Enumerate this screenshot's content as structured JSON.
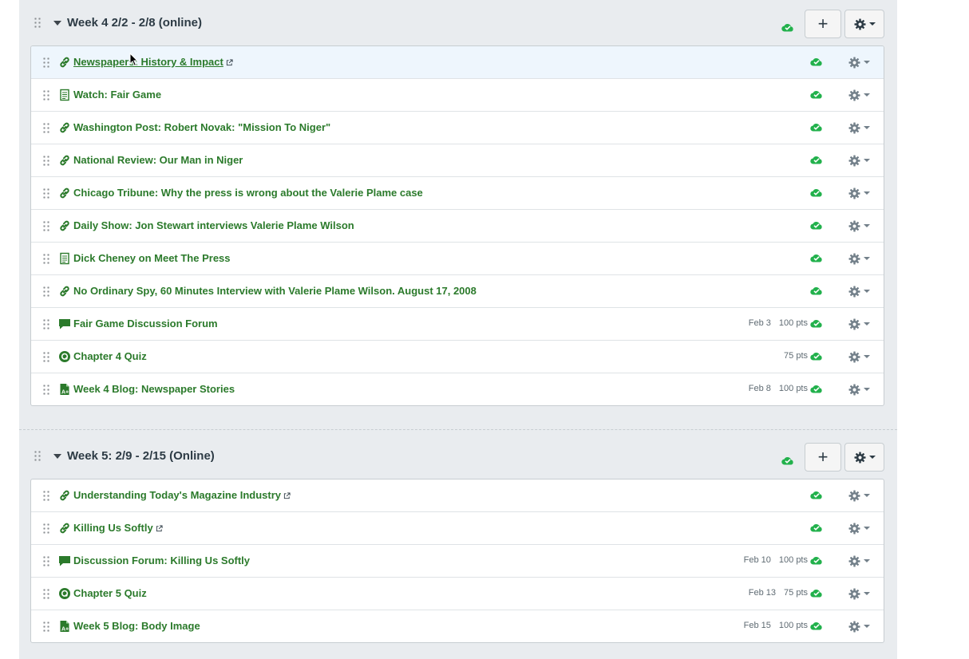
{
  "modules": [
    {
      "title": "Week 4 2/2 - 2/8 (online)",
      "add_label": "+",
      "items": [
        {
          "type": "link",
          "title": "Newspapers: History & Impact",
          "external": true,
          "date": "",
          "points": "",
          "highlight": true
        },
        {
          "type": "page",
          "title": "Watch: Fair Game",
          "external": false,
          "date": "",
          "points": ""
        },
        {
          "type": "link",
          "title": "Washington Post: Robert Novak: \"Mission To Niger\"",
          "external": false,
          "date": "",
          "points": ""
        },
        {
          "type": "link",
          "title": "National Review: Our Man in Niger",
          "external": false,
          "date": "",
          "points": ""
        },
        {
          "type": "link",
          "title": "Chicago Tribune: Why the press is wrong about the Valerie Plame case",
          "external": false,
          "date": "",
          "points": ""
        },
        {
          "type": "link",
          "title": "Daily Show: Jon Stewart interviews Valerie Plame Wilson",
          "external": false,
          "date": "",
          "points": ""
        },
        {
          "type": "page",
          "title": "Dick Cheney on Meet The Press",
          "external": false,
          "date": "",
          "points": ""
        },
        {
          "type": "link",
          "title": "No Ordinary Spy, 60 Minutes Interview with Valerie Plame Wilson. August 17, 2008",
          "external": false,
          "date": "",
          "points": ""
        },
        {
          "type": "discussion",
          "title": "Fair Game Discussion Forum",
          "external": false,
          "date": "Feb 3",
          "points": "100 pts"
        },
        {
          "type": "quiz",
          "title": "Chapter 4 Quiz",
          "external": false,
          "date": "",
          "points": "75 pts"
        },
        {
          "type": "assignment",
          "title": "Week 4 Blog: Newspaper Stories",
          "external": false,
          "date": "Feb 8",
          "points": "100 pts"
        }
      ]
    },
    {
      "title": "Week 5: 2/9 - 2/15 (Online)",
      "add_label": "+",
      "items": [
        {
          "type": "link",
          "title": "Understanding Today's Magazine Industry",
          "external": true,
          "date": "",
          "points": ""
        },
        {
          "type": "link",
          "title": "Killing Us Softly",
          "external": true,
          "date": "",
          "points": ""
        },
        {
          "type": "discussion",
          "title": "Discussion Forum: Killing Us Softly",
          "external": false,
          "date": "Feb 10",
          "points": "100 pts"
        },
        {
          "type": "quiz",
          "title": "Chapter 5 Quiz",
          "external": false,
          "date": "Feb 13",
          "points": "75 pts"
        },
        {
          "type": "assignment",
          "title": "Week 5 Blog: Body Image",
          "external": false,
          "date": "Feb 15",
          "points": "100 pts"
        }
      ]
    }
  ],
  "colors": {
    "item_title": "#2b7a2b",
    "published_cloud": "#22b14c",
    "module_title": "#2d3b45"
  }
}
